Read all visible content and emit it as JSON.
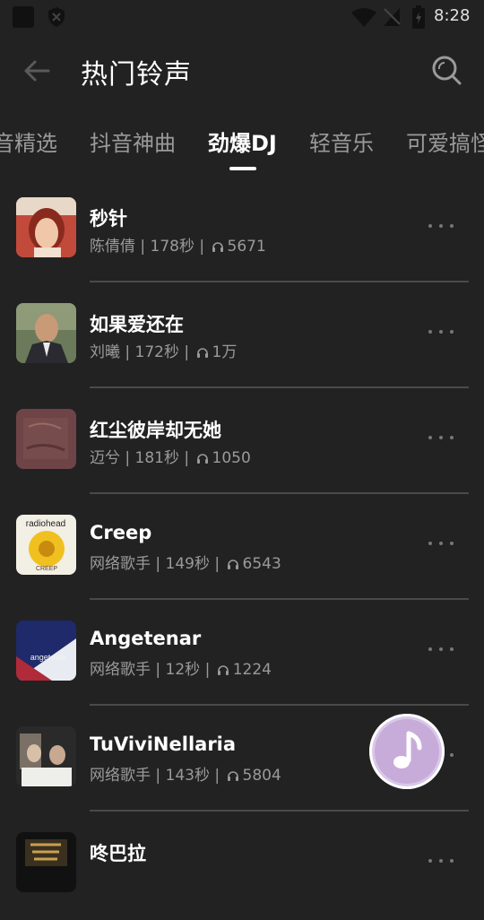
{
  "status_bar": {
    "time": "8:28"
  },
  "header": {
    "title": "热门铃声"
  },
  "tabs": [
    {
      "label": "音精选"
    },
    {
      "label": "抖音神曲"
    },
    {
      "label": "劲爆DJ"
    },
    {
      "label": "轻音乐"
    },
    {
      "label": "可爱搞怪"
    }
  ],
  "active_tab": "劲爆DJ",
  "songs": [
    {
      "title": "秒针",
      "artist": "陈倩倩",
      "duration": "178秒",
      "plays": "5671"
    },
    {
      "title": "如果爱还在",
      "artist": "刘曦",
      "duration": "172秒",
      "plays": "1万"
    },
    {
      "title": "红尘彼岸却无她",
      "artist": "迈兮",
      "duration": "181秒",
      "plays": "1050"
    },
    {
      "title": "Creep",
      "artist": "网络歌手",
      "duration": "149秒",
      "plays": "6543"
    },
    {
      "title": "Angetenar",
      "artist": "网络歌手",
      "duration": "12秒",
      "plays": "1224"
    },
    {
      "title": "TuViviNellaria",
      "artist": "网络歌手",
      "duration": "143秒",
      "plays": "5804"
    },
    {
      "title": "咚巴拉",
      "artist": "",
      "duration": "",
      "plays": ""
    }
  ],
  "cover_texts": {
    "creep_band": "radiohead",
    "creep_sub": "CREEP",
    "angetenar": "angetenar"
  },
  "colors": {
    "background": "#222222",
    "text_secondary": "#9a9a9a",
    "divider": "#4a4a4a",
    "fab": "#c7acd9"
  }
}
